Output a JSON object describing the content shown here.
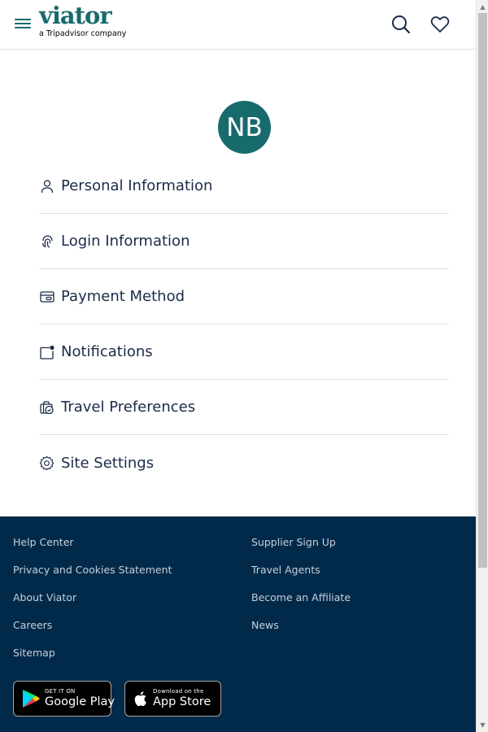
{
  "header": {
    "logo_text": "viator",
    "logo_subtext": "a Tripadvisor company",
    "menu_icon": "hamburger-icon",
    "search_icon": "search-icon",
    "wishlist_icon": "heart-icon"
  },
  "profile": {
    "initials": "NB",
    "avatar_color": "#186b6d"
  },
  "menu": {
    "items": [
      {
        "label": "Personal Information",
        "icon": "user-icon"
      },
      {
        "label": "Login Information",
        "icon": "fingerprint-icon"
      },
      {
        "label": "Payment Method",
        "icon": "credit-card-icon"
      },
      {
        "label": "Notifications",
        "icon": "notification-icon"
      },
      {
        "label": "Travel Preferences",
        "icon": "luggage-icon"
      },
      {
        "label": "Site Settings",
        "icon": "gear-icon"
      }
    ]
  },
  "footer": {
    "background": "#012a4a",
    "left_links": [
      "Help Center",
      "Privacy and Cookies Statement",
      "About Viator",
      "Careers",
      "Sitemap"
    ],
    "right_links": [
      "Supplier Sign Up",
      "Travel Agents",
      "Become an Affiliate",
      "News"
    ],
    "google_play": {
      "small": "GET IT ON",
      "big": "Google Play"
    },
    "app_store": {
      "small": "Download on the",
      "big": "App Store"
    }
  },
  "colors": {
    "brand": "#186b6d",
    "text": "#1a2b49",
    "divider": "#dcdfe4"
  }
}
